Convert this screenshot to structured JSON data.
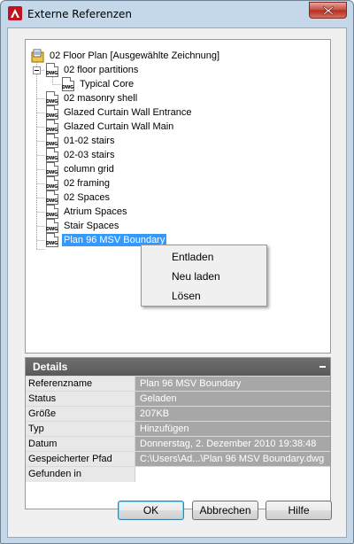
{
  "window": {
    "title": "Externe Referenzen"
  },
  "tree": {
    "root": "02 Floor Plan [Ausgewählte Zeichnung]",
    "items": [
      {
        "label": "02 floor partitions",
        "children": [
          "Typical Core"
        ]
      },
      {
        "label": "02 masonry shell"
      },
      {
        "label": "Glazed Curtain Wall Entrance"
      },
      {
        "label": "Glazed Curtain Wall Main"
      },
      {
        "label": "01-02 stairs"
      },
      {
        "label": "02-03 stairs"
      },
      {
        "label": "column grid"
      },
      {
        "label": "02 framing"
      },
      {
        "label": "02 Spaces"
      },
      {
        "label": "Atrium Spaces"
      },
      {
        "label": "Stair Spaces"
      },
      {
        "label": "Plan 96 MSV Boundary"
      }
    ],
    "selected": "Plan 96 MSV Boundary"
  },
  "context_menu": {
    "items": [
      "Entladen",
      "Neu laden",
      "Lösen"
    ]
  },
  "details": {
    "title": "Details",
    "rows": [
      {
        "key": "Referenzname",
        "value": "Plan 96 MSV Boundary"
      },
      {
        "key": "Status",
        "value": "Geladen"
      },
      {
        "key": "Größe",
        "value": "207KB"
      },
      {
        "key": "Typ",
        "value": "Hinzufügen"
      },
      {
        "key": "Datum",
        "value": "Donnerstag, 2. Dezember 2010  19:38:48"
      },
      {
        "key": "Gespeicherter Pfad",
        "value": "C:\\Users\\Ad...\\Plan 96 MSV Boundary.dwg"
      },
      {
        "key": "Gefunden in",
        "value": ""
      }
    ]
  },
  "buttons": {
    "ok": "OK",
    "cancel": "Abbrechen",
    "help": "Hilfe"
  }
}
